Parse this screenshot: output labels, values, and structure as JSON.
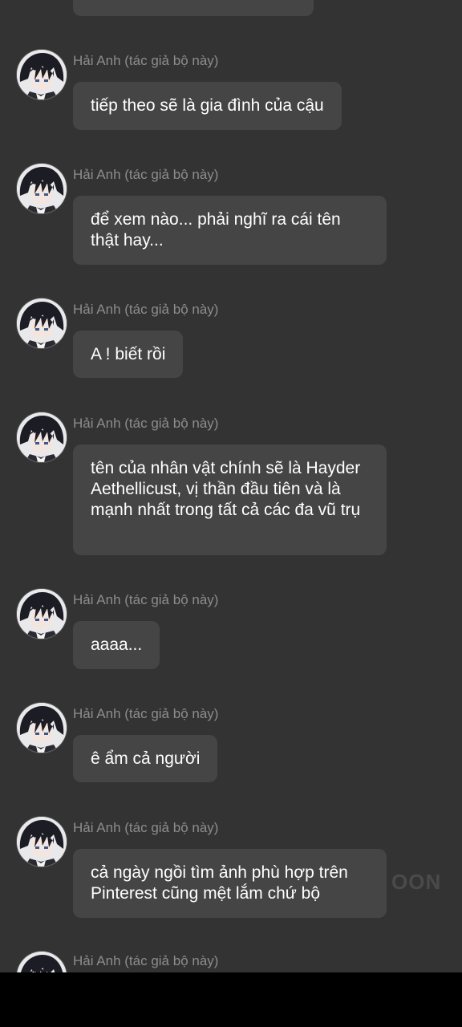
{
  "chat": {
    "messages": [
      {
        "sender": "Hải Anh (tác giả bộ này)",
        "text": "tiếp theo sẽ là gia đình của cậu"
      },
      {
        "sender": "Hải Anh (tác giả bộ này)",
        "text": "để xem nào... phải nghĩ ra cái tên thật hay..."
      },
      {
        "sender": "Hải Anh (tác giả bộ này)",
        "text": "A ! biết rồi"
      },
      {
        "sender": "Hải Anh (tác giả bộ này)",
        "text": "tên của nhân vật chính sẽ là Hayder Aethellicust, vị thần đầu tiên và là mạnh nhất trong tất cả các đa vũ trụ"
      },
      {
        "sender": "Hải Anh (tác giả bộ này)",
        "text": "aaaa..."
      },
      {
        "sender": "Hải Anh (tác giả bộ này)",
        "text": "ê ẩm cả người"
      },
      {
        "sender": "Hải Anh (tác giả bộ này)",
        "text": "cả ngày ngồi tìm ảnh phù hợp trên Pinterest cũng mệt lắm chứ bộ"
      },
      {
        "sender": "Hải Anh (tác giả bộ này)"
      }
    ]
  },
  "watermark": "OON",
  "colors": {
    "background": "#333333",
    "bubble": "#454545",
    "sender_text": "#8d8d8d",
    "message_text": "#ffffff"
  },
  "icons": {
    "avatar": "anime-boy-avatar-icon"
  }
}
